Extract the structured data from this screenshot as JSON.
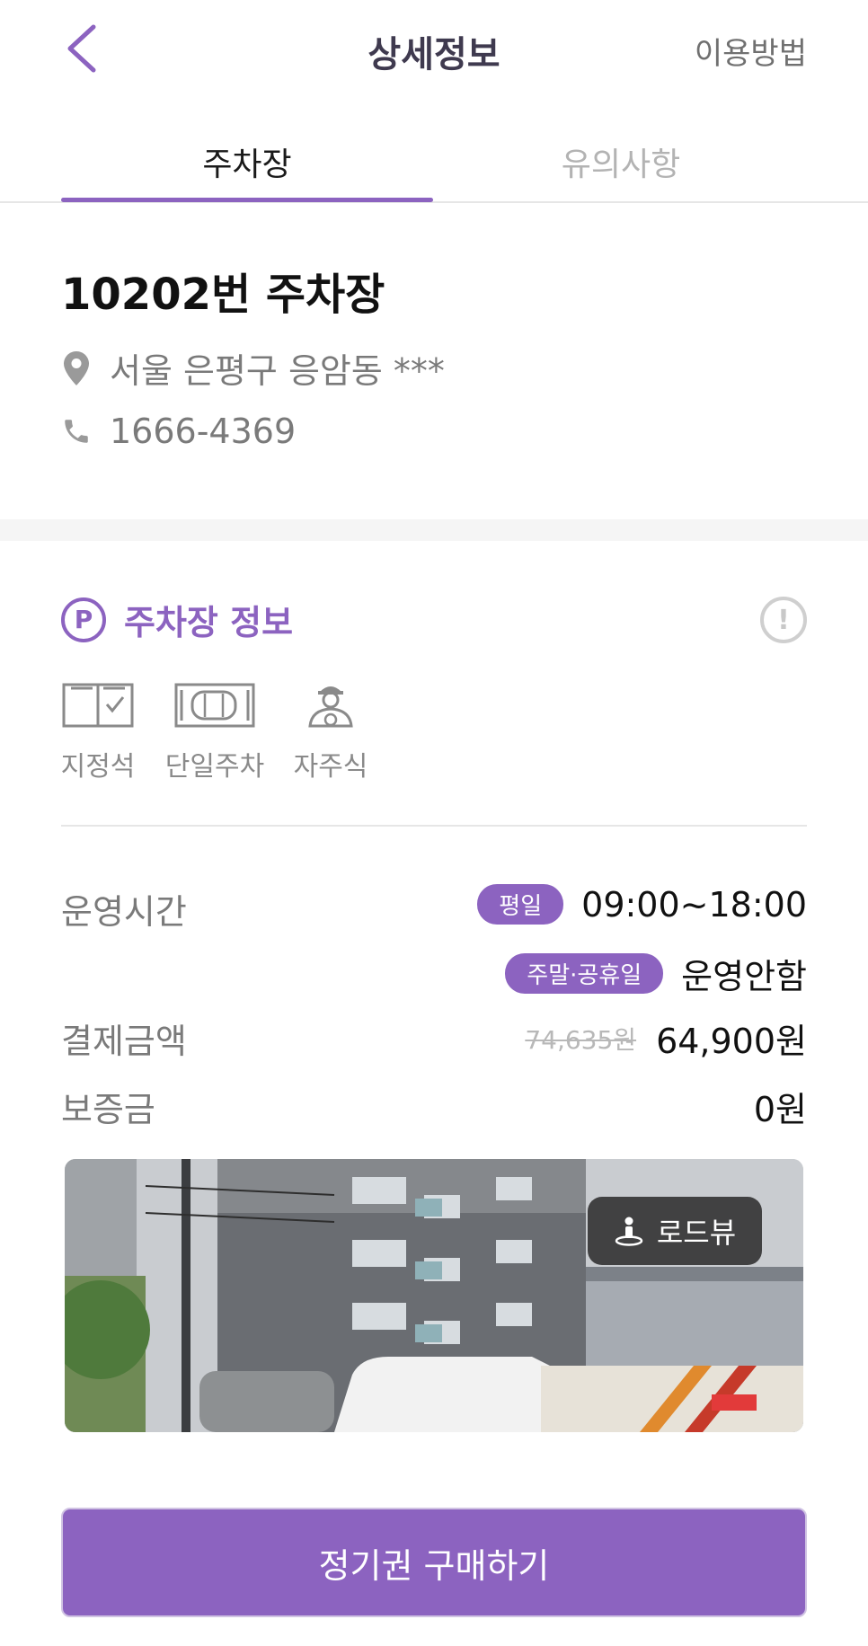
{
  "header": {
    "title": "상세정보",
    "help_label": "이용방법",
    "back_icon": "chevron-left-icon"
  },
  "tabs": [
    {
      "label": "주차장",
      "active": true
    },
    {
      "label": "유의사항",
      "active": false
    }
  ],
  "lot": {
    "name": "10202번 주차장",
    "address": "서울 은평구 응암동 ***",
    "phone": "1666-4369"
  },
  "info_section": {
    "title": "주차장 정보",
    "p_badge": "P",
    "alert_glyph": "!",
    "features": [
      {
        "label": "지정석",
        "icon": "reserved-spot-icon"
      },
      {
        "label": "단일주차",
        "icon": "single-parking-icon"
      },
      {
        "label": "자주식",
        "icon": "self-parking-person-icon"
      }
    ]
  },
  "details": {
    "hours_label": "운영시간",
    "weekday_badge": "평일",
    "weekday_hours": "09:00~18:00",
    "weekend_badge": "주말·공휴일",
    "weekend_hours": "운영안함",
    "payment_label": "결제금액",
    "original_price": "74,635원",
    "price": "64,900원",
    "deposit_label": "보증금",
    "deposit": "0원"
  },
  "photo": {
    "roadview_label": "로드뷰"
  },
  "cta": {
    "buy_label": "정기권 구매하기"
  },
  "colors": {
    "accent": "#8c63c0",
    "muted_text": "#7a7a7a",
    "roadview_bg": "#323232"
  }
}
